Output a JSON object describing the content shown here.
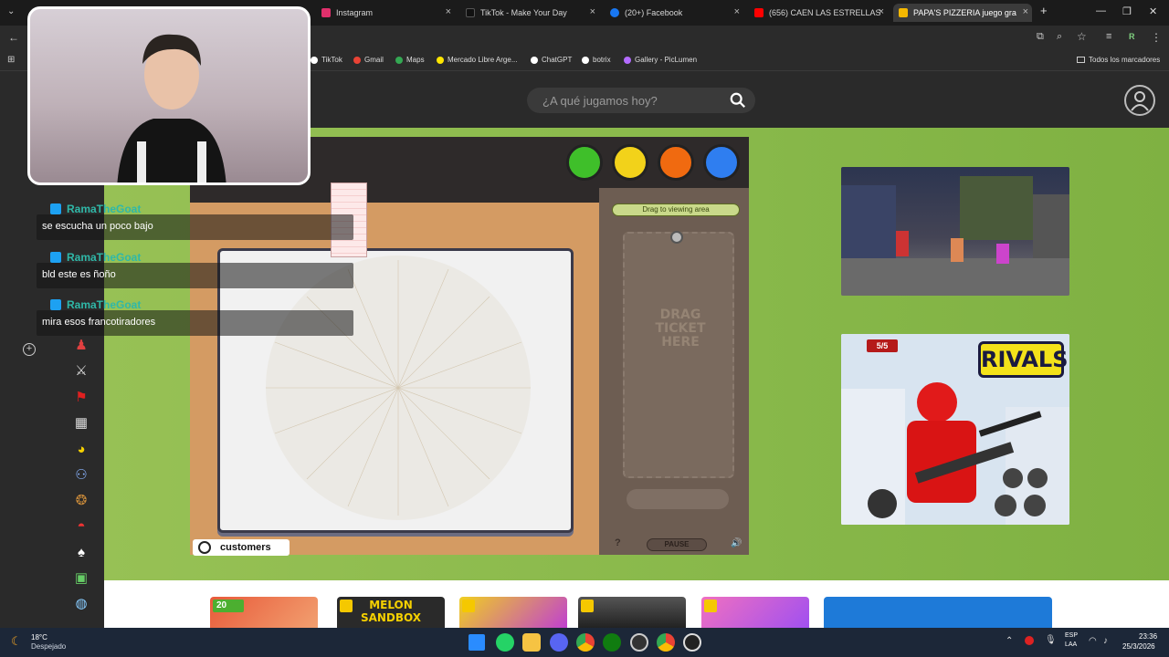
{
  "browser": {
    "tabs": [
      {
        "label": "Instagram",
        "color": "#e1306c"
      },
      {
        "label": "TikTok - Make Your Day",
        "color": "#111111"
      },
      {
        "label": "(20+) Facebook",
        "color": "#1877f2"
      },
      {
        "label": "(656) CAEN LAS ESTRELLAS",
        "color": "#ff0000"
      },
      {
        "label": "PAPA'S PIZZERIA juego gra",
        "color": "#f5b800"
      }
    ],
    "new_tab": "+",
    "bookmarks": [
      {
        "label": "TikTok",
        "color": "#ffffff"
      },
      {
        "label": "Gmail",
        "color": "#ea4335"
      },
      {
        "label": "Maps",
        "color": "#34a853"
      },
      {
        "label": "Mercado Libre Arge...",
        "color": "#ffe600"
      },
      {
        "label": "ChatGPT",
        "color": "#ffffff"
      },
      {
        "label": "botrix",
        "color": "#ffffff"
      },
      {
        "label": "Gallery - PicLumen",
        "color": "#b36bff"
      }
    ],
    "all_bookmarks": "Todos los marcadores",
    "profile_letter": "R"
  },
  "site": {
    "search_placeholder": "¿A qué jugamos hoy?",
    "accent": "#8fbf4f"
  },
  "game": {
    "drag_label": "Drag to viewing area",
    "ticket_text": "DRAG\nTICKET\nHERE",
    "pause_label": "PAUSE",
    "help_label": "?",
    "customers_label": "customers",
    "station_buttons": [
      {
        "name": "order-station",
        "color": "#3fbf2a"
      },
      {
        "name": "topping-station",
        "color": "#f2d21a"
      },
      {
        "name": "bake-station",
        "color": "#f06a10"
      },
      {
        "name": "cut-station",
        "color": "#2f7ef0"
      }
    ]
  },
  "thumbnails": {
    "rivals_title": "RIVALS",
    "health": "5/5"
  },
  "bottom_games": {
    "badge_count": "20",
    "melon_title": "MELON\nSANDBOX"
  },
  "chat": [
    {
      "user": "RamaTheGoat",
      "message": "se escucha un poco bajo"
    },
    {
      "user": "RamaTheGoat",
      "message": "bld este es ñoño"
    },
    {
      "user": "RamaTheGoat",
      "message": "mira esos francotiradores"
    }
  ],
  "taskbar": {
    "temperature": "18°C",
    "weather": "Despejado",
    "lang_1": "ESP",
    "lang_2": "LAA",
    "time": "23:36",
    "date": "25/3/2026"
  }
}
